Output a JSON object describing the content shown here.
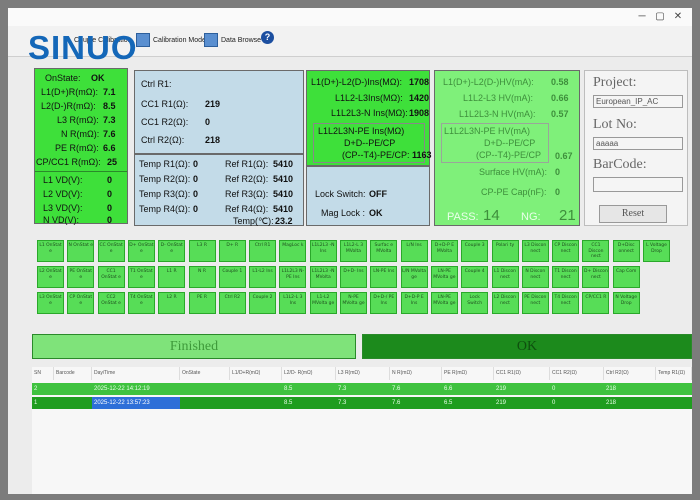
{
  "toolbar": {
    "items": [
      {
        "label": "Couple Calibration"
      },
      {
        "label": "Calibration Mode"
      },
      {
        "label": "Data Browse"
      }
    ],
    "logo": "SINUO",
    "help": "?"
  },
  "status_panel": {
    "rows": [
      {
        "label": "OnState:",
        "value": "OK"
      },
      {
        "label": "L1(D+)R(mΩ):",
        "value": "7.1"
      },
      {
        "label": "L2(D-)R(mΩ):",
        "value": "8.5"
      },
      {
        "label": "L3 R(mΩ):",
        "value": "7.3"
      },
      {
        "label": "N R(mΩ):",
        "value": "7.6"
      },
      {
        "label": "PE R(mΩ):",
        "value": "6.6"
      },
      {
        "label": "CP/CC1 R(mΩ):",
        "value": "25"
      }
    ],
    "voltages": [
      {
        "label": "L1 VD(V):",
        "value": "0"
      },
      {
        "label": "L2 VD(V):",
        "value": "0"
      },
      {
        "label": "L3 VD(V):",
        "value": "0"
      },
      {
        "label": "N VD(V):",
        "value": "0"
      }
    ]
  },
  "ctrl_panel": {
    "title": "Ctrl R1:",
    "rows": [
      {
        "label": "CC1 R1(Ω):",
        "value": "219"
      },
      {
        "label": "CC1 R2(Ω):",
        "value": "0"
      },
      {
        "label": "Ctrl R2(Ω):",
        "value": "218"
      }
    ],
    "temps": [
      {
        "label": "Temp R1(Ω):",
        "value": "0",
        "ref_label": "Ref R1(Ω):",
        "ref_value": "5410"
      },
      {
        "label": "Temp R2(Ω):",
        "value": "0",
        "ref_label": "Ref R2(Ω):",
        "ref_value": "5410"
      },
      {
        "label": "Temp R3(Ω):",
        "value": "0",
        "ref_label": "Ref R3(Ω):",
        "ref_value": "5410"
      },
      {
        "label": "Temp R4(Ω):",
        "value": "0",
        "ref_label": "Ref R4(Ω):",
        "ref_value": "5410"
      }
    ],
    "temp_c_label": "Temp(℃):",
    "temp_c_value": "23.2"
  },
  "ins_panel": {
    "rows": [
      {
        "label": "L1(D+)-L2(D-)Ins(MΩ):",
        "value": "1708"
      },
      {
        "label": "L1L2-L3Ins(MΩ):",
        "value": "1420"
      },
      {
        "label": "L1L2L3-N Ins(MΩ):",
        "value": "1908"
      }
    ],
    "box": {
      "line1": "L1L2L3N-PE Ins(MΩ)",
      "line2": "D+D--PE/CP",
      "line3": "(CP--T4)-PE/CP:",
      "value": "1163"
    }
  },
  "lock_panel": {
    "lock_label": "Lock Switch:",
    "lock_value": "OFF",
    "mag_label": "Mag Lock :",
    "mag_value": "OK"
  },
  "hv_panel": {
    "rows": [
      {
        "label": "L1(D+)-L2(D-)HV(mA):",
        "value": "0.58"
      },
      {
        "label": "L1L2-L3 HV(mA):",
        "value": "0.66"
      },
      {
        "label": "L1L2L3-N HV(mA):",
        "value": "0.57"
      }
    ],
    "box": {
      "line1": "L1L2L3N-PE HV(mA)",
      "line2": "D+D--PE/CP",
      "line3": "(CP--T4)-PE/CP",
      "value": "0.67"
    },
    "surface_label": "Surface HV(mA):",
    "surface_value": "0",
    "cap_label": "CP-PE Cap(nF):",
    "cap_value": "0",
    "pass_label": "PASS:",
    "pass_value": "14",
    "ng_label": "NG:",
    "ng_value": "21"
  },
  "project_panel": {
    "project_label": "Project:",
    "project_value": "European_IP_AC",
    "lot_label": "Lot No:",
    "lot_value": "aaaaa",
    "barcode_label": "BarCode:",
    "barcode_value": "",
    "reset_label": "Reset"
  },
  "test_grid": {
    "rows": [
      [
        "L1 OnStat e",
        "N OnStat e",
        "CC OnStat e",
        "D+ OnStat e",
        "D- OnStat e",
        "L3 R",
        "D+ R",
        "Ctrl R1",
        "MagLoc k",
        "L1L2L3 -N Ins",
        "L1L2-L 3 MVolta",
        "Surfac e MVolta",
        "L/N Ins",
        "D+D-P E MVolta",
        "Couple 3",
        "Polari ty",
        "L3 Discon nect",
        "CP Discon nect",
        "CC1 Discon nect",
        "D+Disc onnect",
        "L Voltage Drop"
      ],
      [
        "L2 OnStat e",
        "PE OnStat e",
        "CC1 OnStat e",
        "T1 OnStat e",
        "L1 R",
        "N R",
        "Couple 1",
        "L1-L2 Ins",
        "L1L2L3 N-PE Ins",
        "L1L2L3 -N MVolta",
        "D+D- Ins",
        "LN-PE Ins",
        "L/N MVolta ge",
        "LN-PE MVolta ge",
        "Couple 4",
        "L1 Discon nect",
        "N Discon nect",
        "T1 Discon nect",
        "D+ Discon nect",
        "Cap Com",
        ""
      ],
      [
        "L3 OnStat e",
        "CP OnStat e",
        "CC2 OnStat e",
        "T4 OnStat e",
        "L2 R",
        "PE R",
        "Ctrl R2",
        "Couple 2",
        "L1L2-L 3 Ins",
        "L1-L2 MVolta ge",
        "N-PE MVolta ge",
        "D+D-/ PE Ins",
        "D+D-P E Ins",
        "LN-PE MVolta ge",
        "Lock Switch",
        "L2 Discon nect",
        "PE Discon nect",
        "T4 Discon nect",
        "CP/CC1 R",
        "N Voltage Drop",
        ""
      ]
    ]
  },
  "result": {
    "finished": "Finished",
    "ok": "OK"
  },
  "table": {
    "headers": [
      "SN",
      "Barcode",
      "Day/Time",
      "OnState",
      "L1/D+R(mΩ)",
      "L2/D- R(mΩ)",
      "L3 R(mΩ)",
      "N R(mΩ)",
      "PE R(mΩ)",
      "CC1 R1(Ω)",
      "CC1 R2(Ω)",
      "Ctrl R2(Ω)",
      "Temp R1(Ω)"
    ],
    "rows": [
      [
        "2",
        "",
        "2025-12-22 14:12:19",
        "",
        "",
        "8.5",
        "7.3",
        "7.6",
        "6.6",
        "219",
        "0",
        "218",
        ""
      ],
      [
        "1",
        "",
        "2025-12-22 13:57:23",
        "",
        "",
        "8.5",
        "7.3",
        "7.6",
        "6.5",
        "219",
        "0",
        "218",
        ""
      ]
    ]
  },
  "colors": {
    "panel_green": "#3ee03a",
    "panel_blue": "#c3dbe8",
    "cell_green": "#57dd57",
    "ok_green": "#1c8a1c",
    "finished_green": "#7fe37a",
    "selected_blue": "#2e6fd8"
  }
}
